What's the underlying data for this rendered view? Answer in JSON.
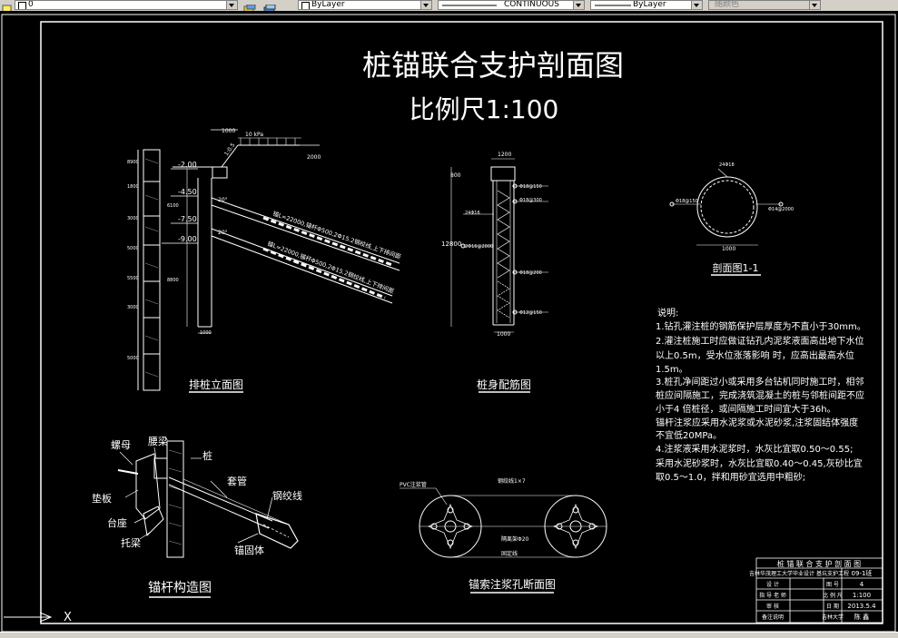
{
  "toolbar": {
    "layer_value": "0",
    "linetype_label": "ByLayer",
    "linetype_name": "CONTINUOUS",
    "lineweight_label": "ByLayer",
    "plotstyle_label": "随颜色"
  },
  "drawing": {
    "title": "桩锚联合支护剖面图",
    "scale": "比例尺1:100",
    "views": {
      "pile_elevation": "排桩立面图",
      "pile_rebar": "桩身配筋图",
      "section_1_1": "剖面图1-1",
      "anchor_construction": "锚杆构造图",
      "anchor_grout_section": "锚索注浆孔断面图"
    },
    "pile_elevation": {
      "dim_top": "1000",
      "load": "10 kPa",
      "dim_right": "2000",
      "slope": "1:0.5",
      "levels": [
        "-2.00",
        "-4.50",
        "-7.50",
        "-9.00"
      ],
      "side_dims": [
        "8900",
        "1800",
        "3000",
        "5000",
        "5500",
        "3000",
        "5000"
      ],
      "anchor_1": "锚L=22000,锚杆Φ500,2Φ15.2钢绞线,上下排间距",
      "anchor_2": "锚L=22000,锚杆Φ500,2Φ15.2钢绞线,上下排间距",
      "inner_dims": [
        "6100",
        "8800"
      ],
      "angle": "20°",
      "bottom_dim": "1000"
    },
    "pile_rebar": {
      "dim_top": "1200",
      "dim_left_top": "800",
      "dim_left": "12800",
      "rebars": [
        "Φ18@150",
        "Φ18@300",
        "Φ18@200",
        "Φ12@150",
        "2Φ16@2000"
      ],
      "left_bar": "24Φ16",
      "bottom_dim": "1000"
    },
    "section": {
      "top_label": "24Φ18",
      "left_label": "Φ18@150",
      "right_label": "Φ14@2000",
      "width": "1000"
    },
    "notes": {
      "heading": "说明:",
      "lines": [
        "1.钻孔灌注桩的钢筋保护层厚度为不直小于30mm。",
        "2.灌注桩施工时应做证钻孔内泥浆液面高出地下水位",
        "以上0.5m，受水位涨落影响 时，应高出最高水位",
        "1.5m。",
        "3.桩孔净间距过小或采用多台钻机同时施工时，相邻",
        "桩应间隔施工，完成浇筑混凝土的桩与邻桩间距不应",
        "小于4 倍桩径，或间隔施工时间宜大于36h。",
        "锚杆注浆应采用水泥浆或水泥砂浆,注浆固结体强度",
        "不宜低20MPa。",
        "4.注浆液采用水泥浆时，水灰比宜取0.50～0.55;",
        "采用水泥砂浆时，水灰比宜取0.40～0.45,灰砂比宜",
        "取0.5～1.0，拌和用砂宜选用中粗砂;"
      ]
    },
    "anchor_labels": {
      "nut": "螺母",
      "waist_beam": "腰梁",
      "pile": "桩",
      "pad": "垫板",
      "sleeve": "套管",
      "strand": "钢绞线",
      "base": "台座",
      "bracket": "托梁",
      "anchor_body": "锚固体"
    },
    "grout_labels": {
      "pvc": "PVC注浆管",
      "strand": "钢绞线1×7",
      "spacer": "隔离架Φ20",
      "wire": "固定线"
    },
    "title_block": {
      "title": "桩 锚 联 合 支 护 剖 面 图",
      "rows": [
        [
          "吉林华茂理工大学毕业设计 基坑支护工程",
          "09-1班"
        ],
        [
          "设  计",
          "",
          "图  号",
          "4"
        ],
        [
          "指  导  老  师",
          "",
          "比 例 尺",
          "1:100"
        ],
        [
          "审  核",
          "",
          "日  期",
          "2013.5.4"
        ],
        [
          "备注说明",
          "",
          "吉林大学",
          "陈  鑫"
        ]
      ]
    }
  },
  "ucs_label": "X"
}
